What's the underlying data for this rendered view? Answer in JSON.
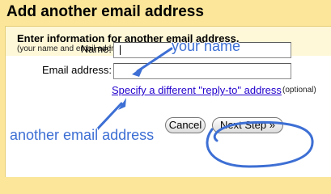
{
  "dialog": {
    "title": "Add another email address",
    "heading": "Enter information for another email address.",
    "subnote": "(your name and email address will be shown"
  },
  "form": {
    "name_label": "Name:",
    "name_value": "",
    "email_label": "Email address:",
    "email_value": "",
    "reply_to_link": "Specify a different \"reply-to\" address",
    "optional_note": "(optional)"
  },
  "buttons": {
    "cancel": "Cancel",
    "next": "Next Step »"
  },
  "annotations": {
    "name_hint": "your name",
    "email_hint": "another email address",
    "color": "#3d6fd4"
  },
  "colors": {
    "frame": "#fbe69a",
    "header_bg": "#fff8d8",
    "link": "#2200cc"
  }
}
